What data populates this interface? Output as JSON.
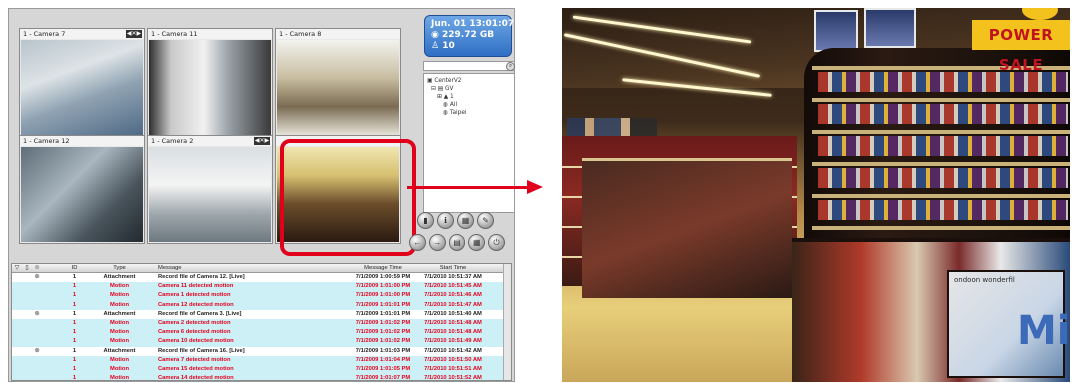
{
  "cameras": [
    {
      "title": "1 - Camera 7"
    },
    {
      "title": "1 - Camera 11"
    },
    {
      "title": "1 - Camera 8"
    },
    {
      "title": "1 - Camera 12"
    },
    {
      "title": "1 - Camera 2"
    },
    {
      "title": ""
    }
  ],
  "info": {
    "datetime": "Jun. 01 13:01:07",
    "storage": "229.72 GB",
    "count": "10"
  },
  "tree": {
    "items": [
      "CenterV2",
      "GV",
      "1",
      "All",
      "Taipei"
    ]
  },
  "log": {
    "headers": {
      "id": "ID",
      "type": "Type",
      "message": "Message",
      "message_time": "Message Time",
      "start_time": "Start Time"
    },
    "rows": [
      {
        "id": "1",
        "type": "Attachment",
        "message": "Record file of Camera 12. [Live]",
        "message_time": "7/1/2009 1:00:59 PM",
        "start_time": "7/1/2010 10:51:37 AM"
      },
      {
        "id": "1",
        "type": "Motion",
        "message": "Camera 11 detected motion",
        "message_time": "7/1/2009 1:01:00 PM",
        "start_time": "7/1/2010 10:51:45 AM"
      },
      {
        "id": "1",
        "type": "Motion",
        "message": "Camera 1 detected motion",
        "message_time": "7/1/2009 1:01:00 PM",
        "start_time": "7/1/2010 10:51:46 AM"
      },
      {
        "id": "1",
        "type": "Motion",
        "message": "Camera 12 detected motion",
        "message_time": "7/1/2009 1:01:01 PM",
        "start_time": "7/1/2010 10:51:47 AM"
      },
      {
        "id": "1",
        "type": "Attachment",
        "message": "Record file of Camera 3. [Live]",
        "message_time": "7/1/2009 1:01:01 PM",
        "start_time": "7/1/2010 10:51:40 AM"
      },
      {
        "id": "1",
        "type": "Motion",
        "message": "Camera 2 detected motion",
        "message_time": "7/1/2009 1:01:02 PM",
        "start_time": "7/1/2010 10:51:48 AM"
      },
      {
        "id": "1",
        "type": "Motion",
        "message": "Camera 6 detected motion",
        "message_time": "7/1/2009 1:01:02 PM",
        "start_time": "7/1/2010 10:51:48 AM"
      },
      {
        "id": "1",
        "type": "Motion",
        "message": "Camera 10 detected motion",
        "message_time": "7/1/2009 1:01:02 PM",
        "start_time": "7/1/2010 10:51:49 AM"
      },
      {
        "id": "1",
        "type": "Attachment",
        "message": "Record file of Camera 16. [Live]",
        "message_time": "7/1/2009 1:01:03 PM",
        "start_time": "7/1/2010 10:51:42 AM"
      },
      {
        "id": "1",
        "type": "Motion",
        "message": "Camera 7 detected motion",
        "message_time": "7/1/2009 1:01:04 PM",
        "start_time": "7/1/2010 10:51:50 AM"
      },
      {
        "id": "1",
        "type": "Motion",
        "message": "Camera 15 detected motion",
        "message_time": "7/1/2009 1:01:05 PM",
        "start_time": "7/1/2010 10:51:51 AM"
      },
      {
        "id": "1",
        "type": "Motion",
        "message": "Camera 14 detected motion",
        "message_time": "7/1/2009 1:01:07 PM",
        "start_time": "7/1/2010 10:51:52 AM"
      }
    ]
  },
  "photo": {
    "sign": "POWER SALE",
    "ad_small": "ondoon wonderfil",
    "ad_big": "Mik"
  },
  "colors": {
    "highlight": "#e0001b",
    "motion_text": "#e8001c",
    "row_alt": "#cdf0f6",
    "info_bg": "#2f6fc4"
  }
}
